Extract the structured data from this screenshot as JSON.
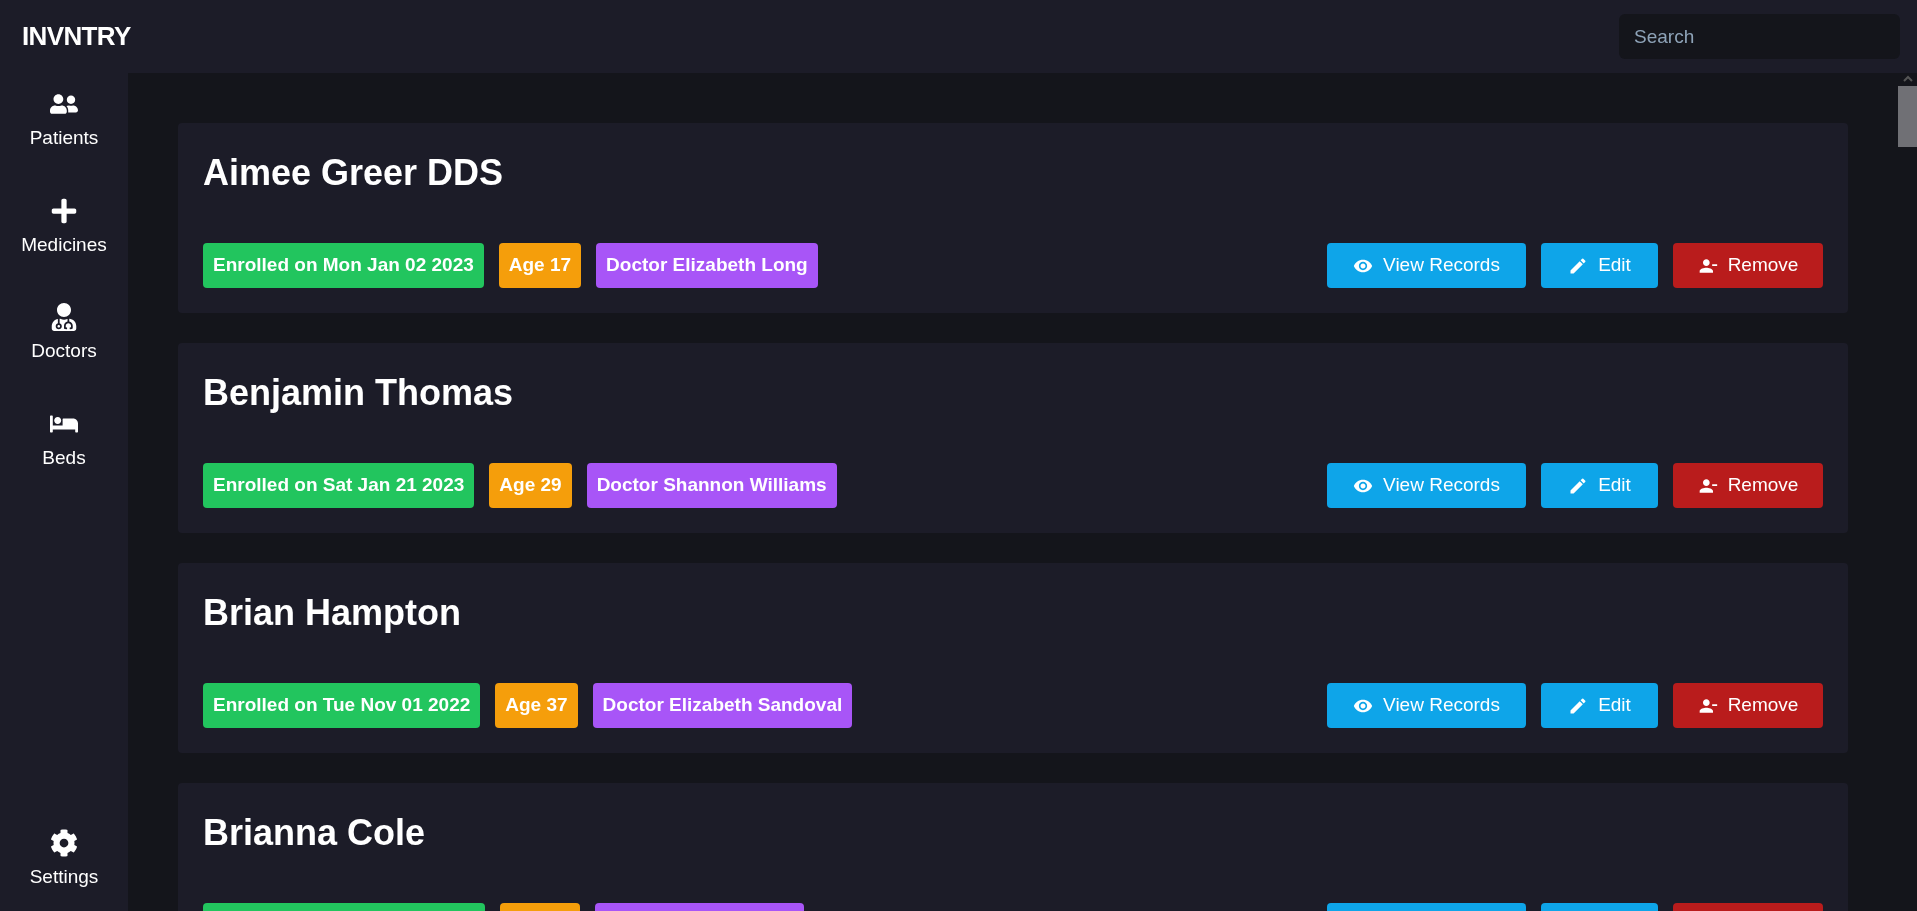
{
  "brand": "INVNTRY",
  "search": {
    "placeholder": "Search"
  },
  "sidebar": {
    "items": [
      {
        "label": "Patients"
      },
      {
        "label": "Medicines"
      },
      {
        "label": "Doctors"
      },
      {
        "label": "Beds"
      }
    ],
    "footer_item": {
      "label": "Settings"
    }
  },
  "patients": [
    {
      "name": "Aimee Greer DDS",
      "enrolled": "Enrolled on Mon Jan 02 2023",
      "age": "Age 17",
      "doctor": "Doctor Elizabeth Long",
      "actions": [
        {
          "label": "View Records",
          "kind": "view"
        },
        {
          "label": "Edit",
          "kind": "edit"
        },
        {
          "label": "Remove",
          "kind": "remove"
        }
      ]
    },
    {
      "name": "Benjamin Thomas",
      "enrolled": "Enrolled on Sat Jan 21 2023",
      "age": "Age 29",
      "doctor": "Doctor Shannon Williams",
      "actions": [
        {
          "label": "View Records",
          "kind": "view"
        },
        {
          "label": "Edit",
          "kind": "edit"
        },
        {
          "label": "Remove",
          "kind": "remove"
        }
      ]
    },
    {
      "name": "Brian Hampton",
      "enrolled": "Enrolled on Tue Nov 01 2022",
      "age": "Age 37",
      "doctor": "Doctor Elizabeth Sandoval",
      "actions": [
        {
          "label": "View Records",
          "kind": "view"
        },
        {
          "label": "Edit",
          "kind": "edit"
        },
        {
          "label": "Remove",
          "kind": "remove"
        }
      ]
    },
    {
      "name": "Brianna Cole",
      "kind": "partial",
      "actions": [
        {
          "kind": "view"
        },
        {
          "kind": "edit"
        },
        {
          "kind": "remove"
        }
      ]
    }
  ]
}
